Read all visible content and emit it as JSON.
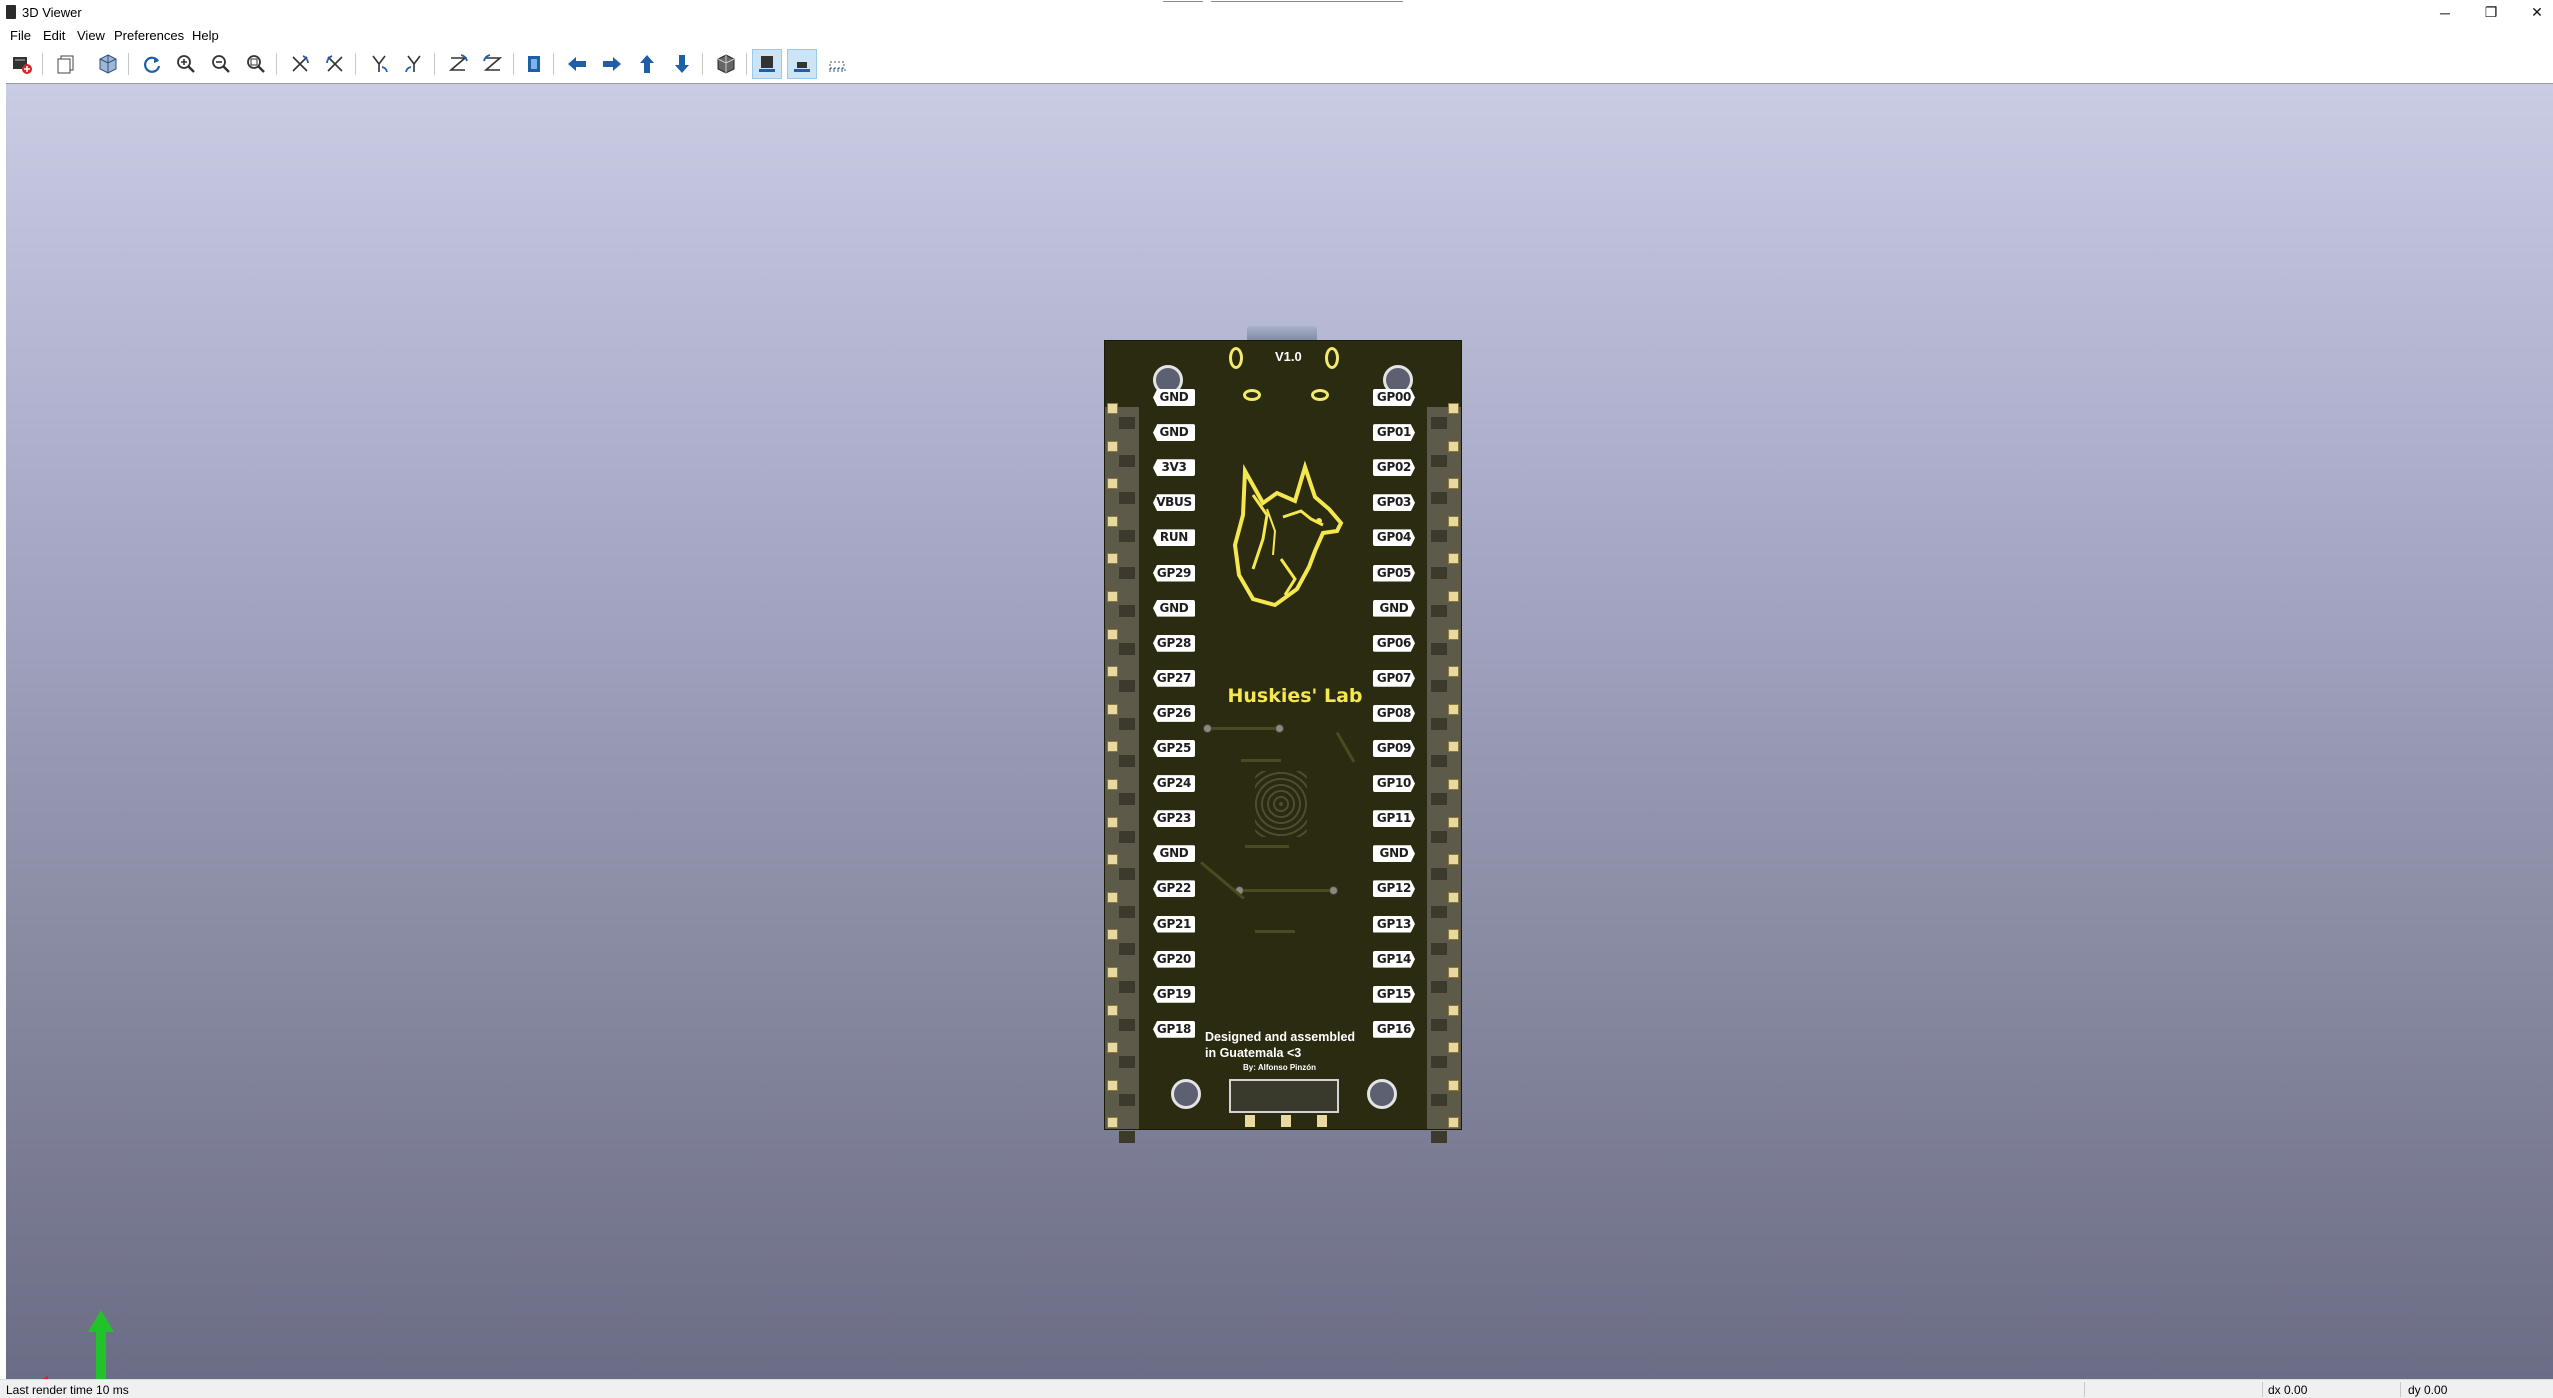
{
  "window": {
    "title": "3D Viewer",
    "minimize_glyph": "─",
    "restore_glyph": "❐",
    "close_glyph": "✕"
  },
  "menu": {
    "items": [
      "File",
      "Edit",
      "View",
      "Preferences",
      "Help"
    ]
  },
  "toolbar": {
    "tools": [
      {
        "name": "reload-board-tool",
        "icon": "reload-board-icon",
        "active": false
      },
      {
        "name": "copy-image-tool",
        "icon": "copy-image-icon",
        "active": false
      },
      {
        "name": "raytrace-tool",
        "icon": "cube-shaded-icon",
        "active": false
      },
      {
        "name": "redraw-tool",
        "icon": "refresh-icon",
        "active": false
      },
      {
        "name": "zoom-in-tool",
        "icon": "zoom-in-icon",
        "active": false
      },
      {
        "name": "zoom-out-tool",
        "icon": "zoom-out-icon",
        "active": false
      },
      {
        "name": "zoom-fit-tool",
        "icon": "zoom-fit-icon",
        "active": false
      },
      {
        "name": "rotate-x-cw-tool",
        "icon": "rotate-x-cw-icon",
        "active": false
      },
      {
        "name": "rotate-x-ccw-tool",
        "icon": "rotate-x-ccw-icon",
        "active": false
      },
      {
        "name": "rotate-y-cw-tool",
        "icon": "rotate-y-cw-icon",
        "active": false
      },
      {
        "name": "rotate-y-ccw-tool",
        "icon": "rotate-y-ccw-icon",
        "active": false
      },
      {
        "name": "rotate-z-cw-tool",
        "icon": "rotate-z-cw-icon",
        "active": false
      },
      {
        "name": "rotate-z-ccw-tool",
        "icon": "rotate-z-ccw-icon",
        "active": false
      },
      {
        "name": "flip-board-tool",
        "icon": "flip-board-icon",
        "active": false
      },
      {
        "name": "move-left-tool",
        "icon": "arrow-left-icon",
        "active": false
      },
      {
        "name": "move-right-tool",
        "icon": "arrow-right-icon",
        "active": false
      },
      {
        "name": "move-up-tool",
        "icon": "arrow-up-icon",
        "active": false
      },
      {
        "name": "move-down-tool",
        "icon": "arrow-down-icon",
        "active": false
      },
      {
        "name": "render-options-tool",
        "icon": "render-options-icon",
        "active": false
      },
      {
        "name": "show-smd-tool",
        "icon": "smd-components-icon",
        "active": true
      },
      {
        "name": "show-tht-tool",
        "icon": "tht-components-icon",
        "active": true
      },
      {
        "name": "show-virtual-tool",
        "icon": "virtual-components-icon",
        "active": false
      }
    ]
  },
  "board": {
    "version": "V1.0",
    "brand": "Huskies' Lab",
    "credit_line1": "Designed and assembled",
    "credit_line2": "in Guatemala <3",
    "credit_line3": "By: Alfonso Pinzón",
    "left_pins": [
      "GND",
      "GND",
      "3V3",
      "VBUS",
      "RUN",
      "GP29",
      "GND",
      "GP28",
      "GP27",
      "GP26",
      "GP25",
      "GP24",
      "GP23",
      "GND",
      "GP22",
      "GP21",
      "GP20",
      "GP19",
      "GP18"
    ],
    "right_pins": [
      "GP00",
      "GP01",
      "GP02",
      "GP03",
      "GP04",
      "GP05",
      "GND",
      "GP06",
      "GP07",
      "GP08",
      "GP09",
      "GP10",
      "GP11",
      "GND",
      "GP12",
      "GP13",
      "GP14",
      "GP15",
      "GP16"
    ],
    "mask_color": "#2b2b12",
    "silk_color": "#f5e84e"
  },
  "axes": {
    "x_color": "#e01c1c",
    "y_color": "#22c32a",
    "z_color": "#1c3ee0"
  },
  "status": {
    "render_time": "Last render time 10 ms",
    "dx": "dx 0.00",
    "dy": "dy 0.00"
  }
}
